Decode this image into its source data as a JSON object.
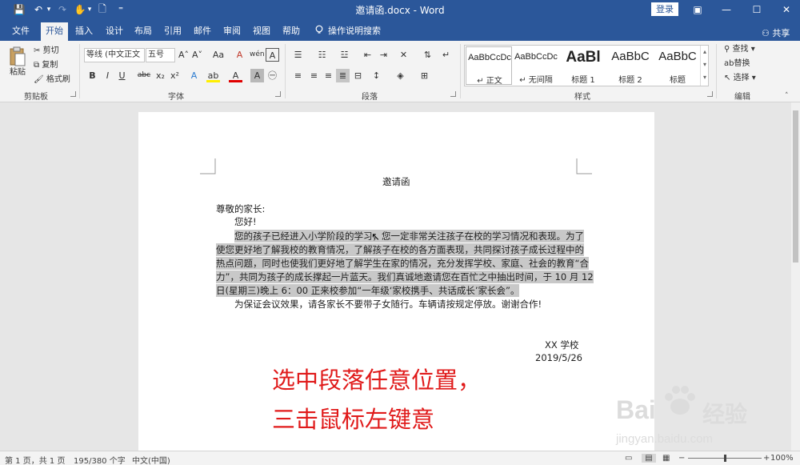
{
  "window": {
    "title": "邀请函.docx - Word",
    "login_label": "登录",
    "controls": {
      "ribbon_options": "▣",
      "minimize": "—",
      "maximize": "☐",
      "close": "✕"
    }
  },
  "quick_access": {
    "save": "💾",
    "undo": "↶",
    "undo_dropdown": "▾",
    "redo": "↷",
    "touch_mode": "✋",
    "touch_dropdown": "▾",
    "new": "🗋",
    "customize": "⁼"
  },
  "tabs": [
    "文件",
    "开始",
    "插入",
    "设计",
    "布局",
    "引用",
    "邮件",
    "审阅",
    "视图",
    "帮助"
  ],
  "active_tab": "开始",
  "tell_me": "操作说明搜索",
  "share": "共享",
  "ribbon": {
    "clipboard": {
      "label": "剪贴板",
      "paste": "粘贴",
      "cut": "剪切",
      "copy": "复制",
      "format_painter": "格式刷"
    },
    "font": {
      "label": "字体",
      "font_name": "等线 (中文正文",
      "font_size": "五号",
      "bold": "B",
      "italic": "I",
      "underline": "U",
      "strike": "abc",
      "subscript": "x₂",
      "superscript": "x²",
      "grow": "A˄",
      "shrink": "A˅",
      "change_case": "Aa",
      "clear_format": "A",
      "phonetic": "wén",
      "char_border": "A",
      "text_effect": "A",
      "highlight": "ab",
      "font_color": "A",
      "shading": "A",
      "enclose": "㊀"
    },
    "paragraph": {
      "label": "段落"
    },
    "styles": {
      "label": "样式",
      "items": [
        {
          "preview": "AaBbCcDc",
          "name": "↵ 正文"
        },
        {
          "preview": "AaBbCcDc",
          "name": "↵ 无间隔"
        },
        {
          "preview": "AaBl",
          "name": "标题 1"
        },
        {
          "preview": "AaBbC",
          "name": "标题 2"
        },
        {
          "preview": "AaBbC",
          "name": "标题"
        }
      ]
    },
    "editing": {
      "label": "编辑",
      "find": "查找",
      "replace": "替换",
      "select": "选择"
    }
  },
  "document": {
    "title": "邀请函",
    "salutation": "尊敬的家长:",
    "greeting": "您好!",
    "body_lines": [
      "您的孩子已经进入小学阶段的学习，您一定非常关注孩子在校的学习情况和表现。为了",
      "使您更好地了解我校的教育情况，了解孩子在校的各方面表现，共同探讨孩子成长过程中的",
      "热点问题，同时也使我们更好地了解学生在家的情况，充分发挥学校、家庭、社会的教育“合",
      "力”，共同为孩子的成长撑起一片蓝天。我们真诚地邀请您在百忙之中抽出时间，于 10 月 12",
      "日(星期三)晚上 6：00 正来校参加“一年级‘家校携手、共话成长’家长会”。"
    ],
    "closing": "为保证会议效果，请各家长不要带子女随行。车辆请按规定停放。谢谢合作!",
    "signature": "XX 学校",
    "date": "2019/5/26"
  },
  "annotation": {
    "line1": "选中段落任意位置，",
    "line2": "三击鼠标左键意"
  },
  "watermark": {
    "brand": "Bai",
    "brand2": "经验",
    "url": "jingyan.baidu.com"
  },
  "status": {
    "page": "第 1 页，共 1 页",
    "words": "195/380 个字",
    "language": "中文(中国)",
    "zoom": "100%",
    "zoom_level": 1.0
  },
  "colors": {
    "ribbon_blue": "#2b579a",
    "selection_gray": "#c8c8c8",
    "annotation_red": "#e01a1a"
  }
}
